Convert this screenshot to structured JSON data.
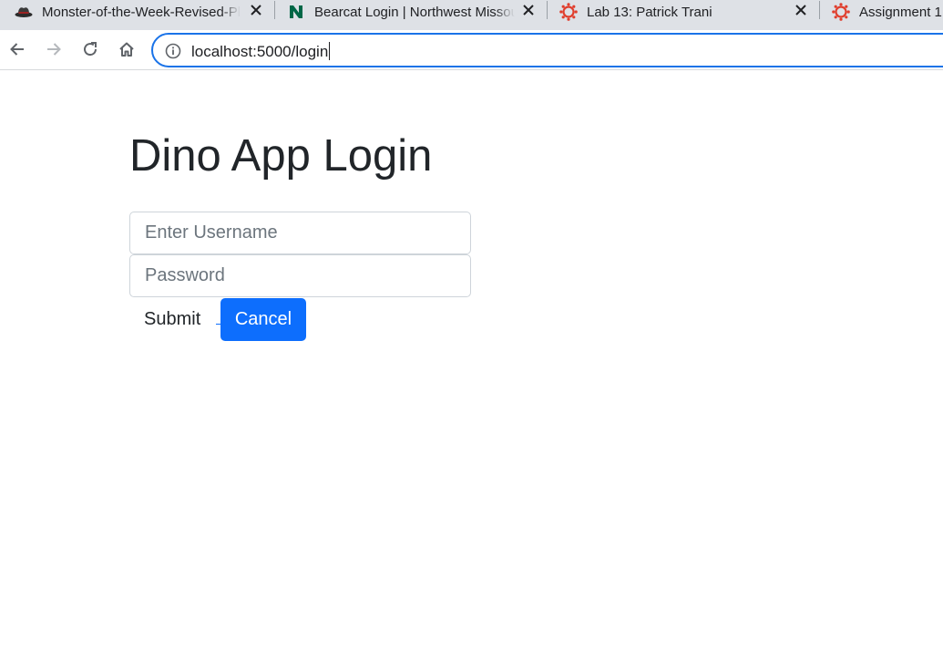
{
  "browser": {
    "tabs": [
      {
        "title": "Monster-of-the-Week-Revised-Pl",
        "favicon": "fedora-hat-icon"
      },
      {
        "title": "Bearcat Login | Northwest Missou",
        "favicon": "northwest-n-icon"
      },
      {
        "title": "Lab 13: Patrick Trani",
        "favicon": "canvas-icon"
      },
      {
        "title": "Assignment 1",
        "favicon": "canvas-icon"
      }
    ],
    "address_bar": {
      "url": "localhost:5000/login"
    },
    "colors": {
      "tabstrip": "#dee1e6",
      "omnibox_focus": "#1a73e8",
      "canvas_red": "#e03e2d",
      "northwest_green": "#006747"
    }
  },
  "page": {
    "title": "Dino App Login",
    "username": {
      "placeholder": "Enter Username",
      "value": ""
    },
    "password": {
      "placeholder": "Password",
      "value": ""
    },
    "submit_label": "Submit",
    "cancel_label": "Cancel",
    "colors": {
      "primary": "#0d6efd",
      "text": "#212529",
      "placeholder": "#6c757d"
    }
  }
}
